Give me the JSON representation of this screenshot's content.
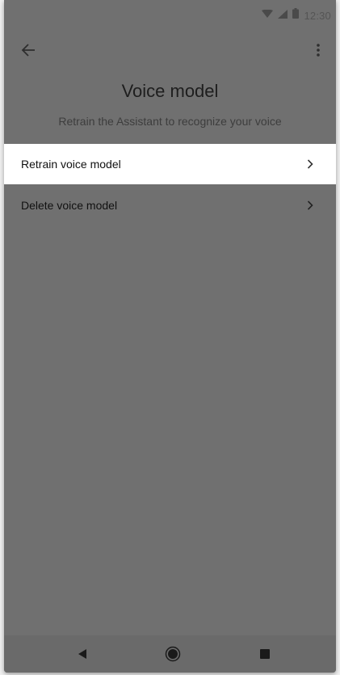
{
  "status_bar": {
    "time": "12:30",
    "icons": [
      "wifi-icon",
      "signal-icon",
      "battery-icon"
    ]
  },
  "app_bar": {
    "back_icon": "arrow-back-icon",
    "more_icon": "more-vert-icon"
  },
  "page": {
    "title": "Voice model",
    "subtitle": "Retrain the Assistant to recognize your voice"
  },
  "menu": {
    "items": [
      {
        "label": "Retrain voice model",
        "icon": "chevron-right-icon",
        "highlighted": true
      },
      {
        "label": "Delete voice model",
        "icon": "chevron-right-icon",
        "highlighted": false
      }
    ]
  },
  "nav_bar": {
    "icons": [
      "nav-back-icon",
      "nav-home-icon",
      "nav-recents-icon"
    ]
  },
  "colors": {
    "overlay_background": "#707070",
    "highlight_row": "#ffffff",
    "title_text": "#1e1e1e",
    "subtitle_text": "#3d3d3d"
  }
}
